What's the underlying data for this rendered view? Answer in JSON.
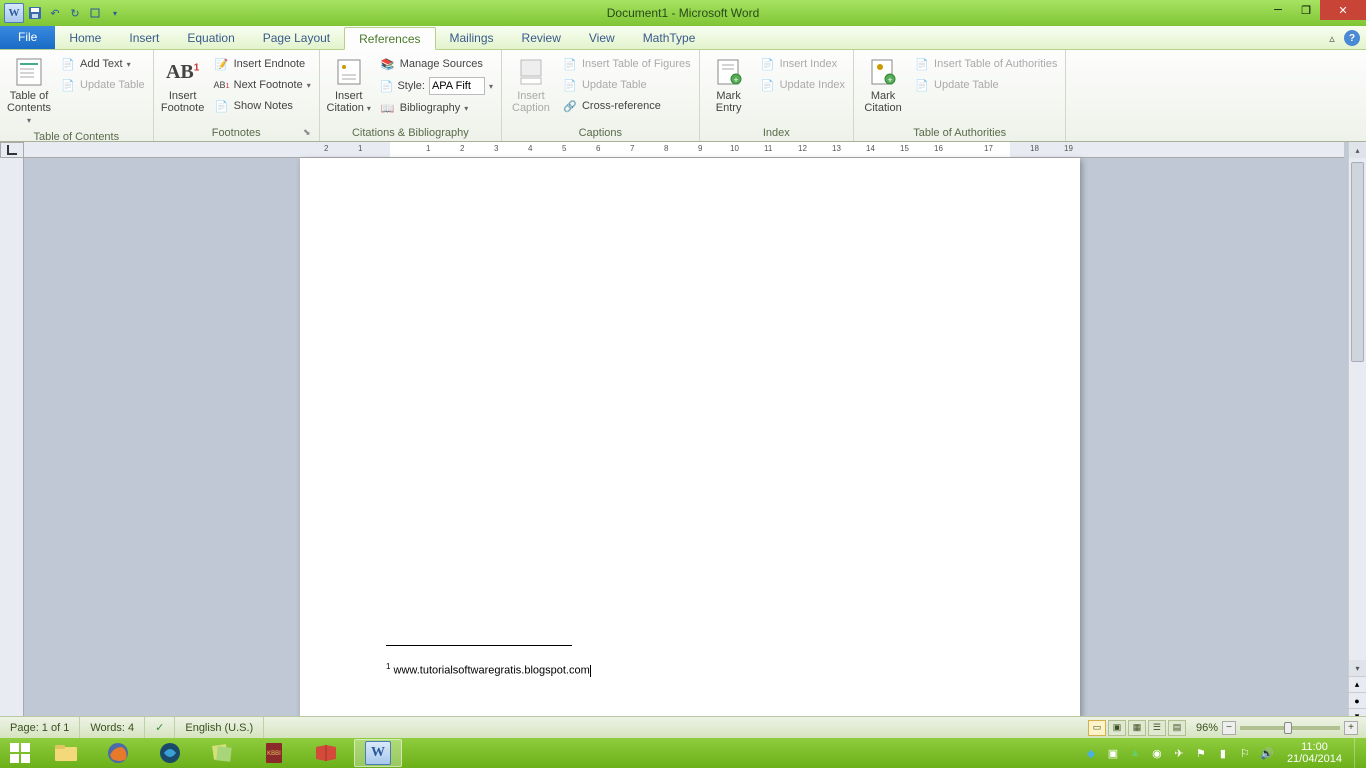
{
  "title": "Document1 - Microsoft Word",
  "qat": {
    "undo": "↶",
    "redo": "↻"
  },
  "tabs": {
    "file": "File",
    "items": [
      "Home",
      "Insert",
      "Equation",
      "Page Layout",
      "References",
      "Mailings",
      "Review",
      "View",
      "MathType"
    ],
    "active_index": 4
  },
  "ribbon": {
    "toc": {
      "label": "Table of Contents",
      "big": "Table of\nContents",
      "add_text": "Add Text",
      "update": "Update Table"
    },
    "footnotes": {
      "label": "Footnotes",
      "big": "Insert\nFootnote",
      "endnote": "Insert Endnote",
      "next": "Next Footnote",
      "show": "Show Notes"
    },
    "citations": {
      "label": "Citations & Bibliography",
      "big": "Insert\nCitation",
      "manage": "Manage Sources",
      "style_lbl": "Style:",
      "style_val": "APA Fift",
      "bib": "Bibliography"
    },
    "captions": {
      "label": "Captions",
      "big": "Insert\nCaption",
      "figures": "Insert Table of Figures",
      "update": "Update Table",
      "cross": "Cross-reference"
    },
    "index": {
      "label": "Index",
      "big": "Mark\nEntry",
      "insert": "Insert Index",
      "update": "Update Index"
    },
    "authorities": {
      "label": "Table of Authorities",
      "big": "Mark\nCitation",
      "insert": "Insert Table of Authorities",
      "update": "Update Table"
    }
  },
  "document": {
    "footnote_num": "1",
    "footnote_text": " www.tutorialsoftwaregratis.blogspot.com"
  },
  "status": {
    "page": "Page: 1 of 1",
    "words": "Words: 4",
    "lang": "English (U.S.)",
    "zoom": "96%"
  },
  "tray": {
    "time": "11:00",
    "date": "21/04/2014"
  }
}
